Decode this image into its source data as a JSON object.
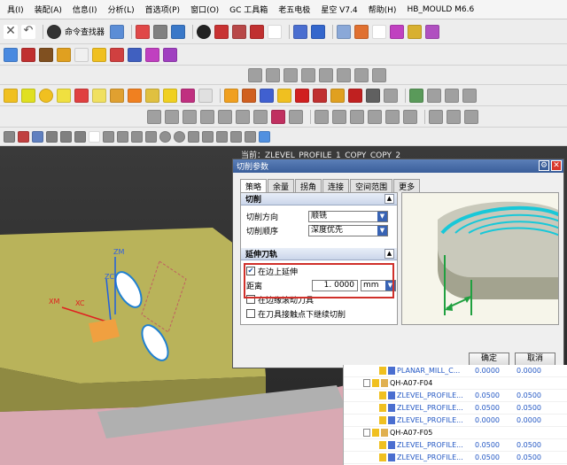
{
  "menu": [
    "具(I)",
    "装配(A)",
    "信息(I)",
    "分析(L)",
    "首选项(P)",
    "窗口(O)",
    "GC 工具箱",
    "老五电极",
    "星空 V7.4",
    "帮助(H)",
    "HB_MOULD M6.6"
  ],
  "toolbar": {
    "command_finder": "命令查找器"
  },
  "current_operation": "当前：ZLEVEL_PROFILE_1_COPY_COPY_2",
  "axes": {
    "zm": "ZM",
    "zc": "ZC",
    "xm": "XM",
    "xc": "XC"
  },
  "dialog": {
    "title": "切削参数",
    "tabs": [
      "策略",
      "余量",
      "拐角",
      "连接",
      "空间范围",
      "更多"
    ],
    "active_tab": "策略",
    "section_cut": {
      "header": "切削",
      "cut_direction_label": "切削方向",
      "cut_direction_value": "顺铣",
      "cut_order_label": "切削顺序",
      "cut_order_value": "深度优先"
    },
    "section_extend": {
      "header": "延伸刀轨",
      "extend_at_edge_label": "在边上延伸",
      "extend_at_edge_checked": true,
      "distance_label": "距离",
      "distance_value": "1. 0000",
      "distance_unit": "mm",
      "roll_tool_label": "在边缘滚动刀具",
      "roll_tool_checked": false,
      "continue_contact_label": "在刀具接触点下继续切削",
      "continue_contact_checked": false
    },
    "ok_label": "确定",
    "cancel_label": "取消"
  },
  "tree": [
    {
      "name": "PLANAR_MILL_C...",
      "v1": "0.0000",
      "v2": "0.0000",
      "kind": "op",
      "indent": 1
    },
    {
      "name": "QH-A07-F04",
      "v1": "",
      "v2": "",
      "kind": "group",
      "indent": 0
    },
    {
      "name": "ZLEVEL_PROFILE...",
      "v1": "0.0500",
      "v2": "0.0500",
      "kind": "op",
      "indent": 1
    },
    {
      "name": "ZLEVEL_PROFILE...",
      "v1": "0.0500",
      "v2": "0.0500",
      "kind": "op",
      "indent": 1
    },
    {
      "name": "ZLEVEL_PROFILE...",
      "v1": "0.0000",
      "v2": "0.0000",
      "kind": "op",
      "indent": 1
    },
    {
      "name": "QH-A07-F05",
      "v1": "",
      "v2": "",
      "kind": "group",
      "indent": 0
    },
    {
      "name": "ZLEVEL_PROFILE...",
      "v1": "0.0500",
      "v2": "0.0500",
      "kind": "op",
      "indent": 1
    },
    {
      "name": "ZLEVEL_PROFILE...",
      "v1": "0.0500",
      "v2": "0.0500",
      "kind": "op",
      "indent": 1
    }
  ]
}
